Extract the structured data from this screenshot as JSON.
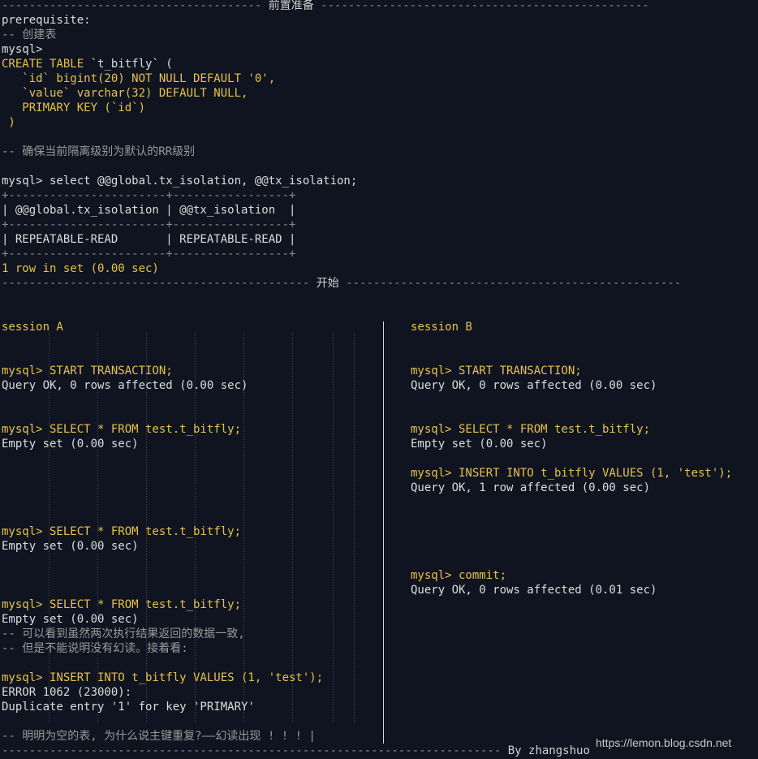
{
  "header": {
    "prep_title": "前置准备",
    "start_title": "开始"
  },
  "prep": {
    "prerequisite": "prerequisite:",
    "comment_create": "-- 创建表",
    "mysql_prompt": "mysql>",
    "create_l1_kw": "CREATE TABLE",
    "create_l1_rest": " `t_bitfly` (",
    "create_l2": "   `id` bigint(20) NOT NULL DEFAULT '0',",
    "create_l3": "   `value` varchar(32) DEFAULT NULL,",
    "create_l4": "   PRIMARY KEY (`id`)",
    "create_l5": " )",
    "comment_rr": "-- 确保当前隔离级别为默认的RR级别",
    "select_iso": "mysql> select @@global.tx_isolation, @@tx_isolation;",
    "tbl_border": "+-----------------------+-----------------+",
    "tbl_header": "| @@global.tx_isolation | @@tx_isolation  |",
    "tbl_row": "| REPEATABLE-READ       | REPEATABLE-READ |",
    "row_count": "1 row in set (0.00 sec)"
  },
  "session_a": {
    "title": "session A",
    "l1": "mysql> START TRANSACTION;",
    "l2": "Query OK, 0 rows affected (0.00 sec)",
    "l3": "mysql> SELECT * FROM test.t_bitfly;",
    "l4": "Empty set (0.00 sec)",
    "l5": "mysql> SELECT * FROM test.t_bitfly;",
    "l6": "Empty set (0.00 sec)",
    "l7": "mysql> SELECT * FROM test.t_bitfly;",
    "l8": "Empty set (0.00 sec)",
    "c1": "-- 可以看到虽然两次执行结果返回的数据一致,",
    "c2": "-- 但是不能说明没有幻读。接着看:",
    "l9": "mysql> INSERT INTO t_bitfly VALUES (1, 'test');",
    "l10": "ERROR 1062 (23000):",
    "l11": "Duplicate entry '1' for key 'PRIMARY'",
    "c3": "-- 明明为空的表, 为什么说主键重复?——幻读出现 ! ! ! |"
  },
  "session_b": {
    "title": "session B",
    "l1": "mysql> START TRANSACTION;",
    "l2": "Query OK, 0 rows affected (0.00 sec)",
    "l3": "mysql> SELECT * FROM test.t_bitfly;",
    "l4": "Empty set (0.00 sec)",
    "l5": "mysql> INSERT INTO t_bitfly VALUES (1, 'test');",
    "l6": "Query OK, 1 row affected (0.00 sec)",
    "l7": "mysql> commit;",
    "l8": "Query OK, 0 rows affected (0.01 sec)"
  },
  "footer": {
    "author": "By zhangshuo",
    "watermark": "https://lemon.blog.csdn.net"
  },
  "colors": {
    "background": "#0f1420",
    "keyword": "#e8c24a",
    "string": "#7ec46a",
    "text": "#dcdcdc",
    "comment": "#9a9a9a"
  }
}
